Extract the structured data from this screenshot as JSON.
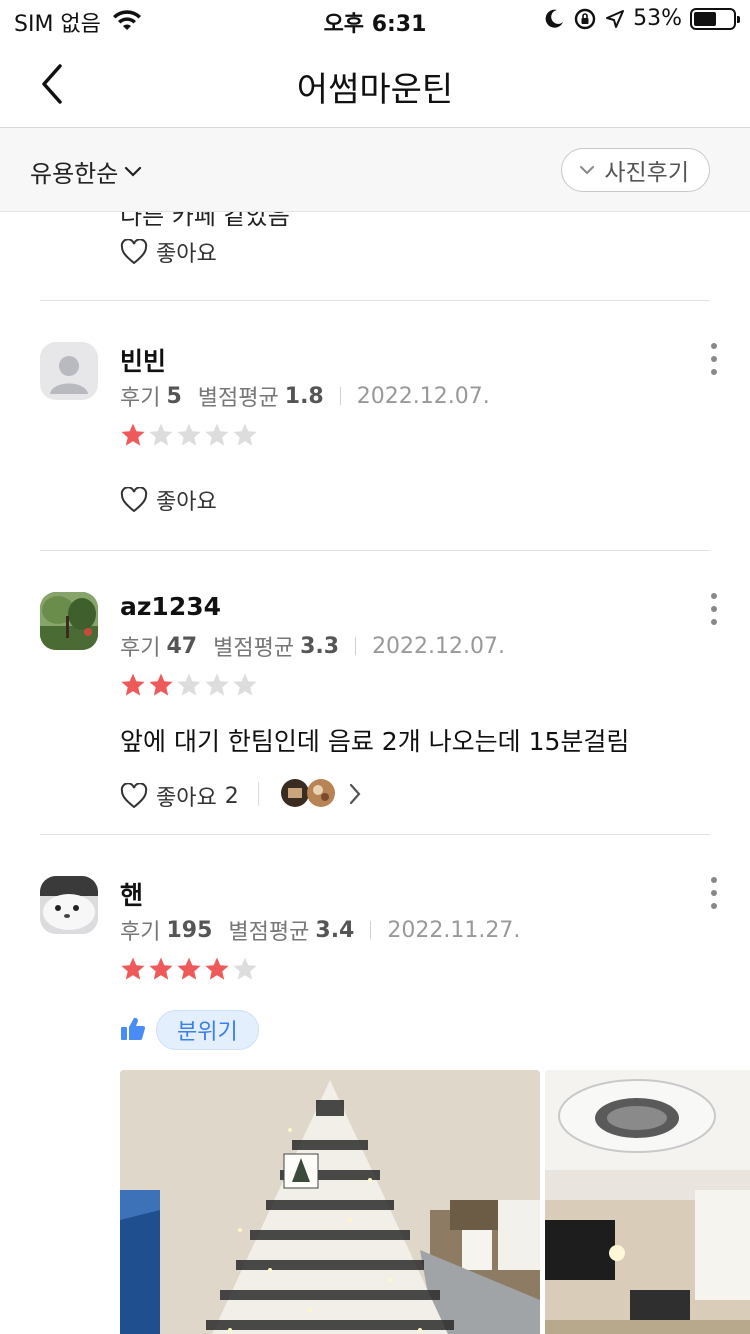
{
  "status_bar": {
    "carrier": "SIM 없음",
    "time": "오후 6:31",
    "battery": "53%"
  },
  "nav": {
    "title": "어썸마운틴"
  },
  "filters": {
    "sort_label": "유용한순",
    "photo_review_label": "사진후기"
  },
  "reviews": [
    {
      "partial_text": "다른 카페 같았음",
      "like_label": "좋아요"
    },
    {
      "name": "빈빈",
      "review_count_label": "후기",
      "review_count": "5",
      "avg_label": "별점평균",
      "avg": "1.8",
      "date": "2022.12.07.",
      "rating": 1,
      "like_label": "좋아요"
    },
    {
      "name": "az1234",
      "review_count_label": "후기",
      "review_count": "47",
      "avg_label": "별점평균",
      "avg": "3.3",
      "date": "2022.12.07.",
      "rating": 2,
      "text": "앞에 대기 한팀인데 음료 2개 나오는데 15분걸림",
      "like_label": "좋아요",
      "like_count": "2"
    },
    {
      "name": "핸",
      "review_count_label": "후기",
      "review_count": "195",
      "avg_label": "별점평균",
      "avg": "3.4",
      "date": "2022.11.27.",
      "rating": 4,
      "tag": "분위기"
    }
  ],
  "colors": {
    "star_filled": "#ee5a5a",
    "star_empty": "#dddddd",
    "tag_blue": "#3b7ef0",
    "thumbs_blue": "#4a8cf7"
  }
}
